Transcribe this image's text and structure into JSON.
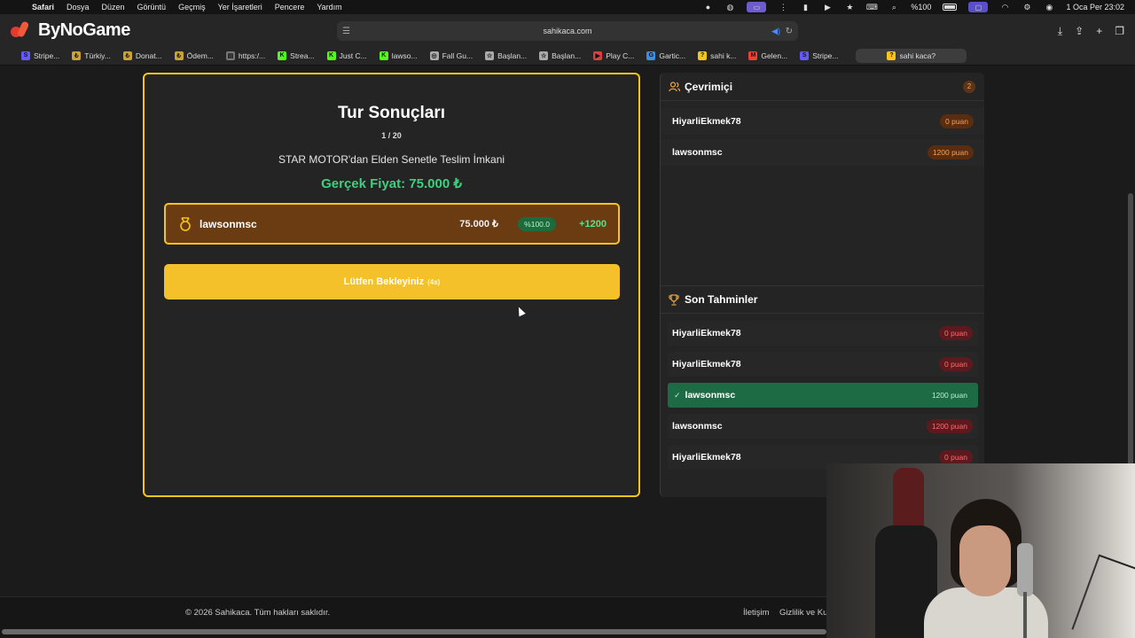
{
  "menubar": {
    "app": "Safari",
    "items": [
      "Dosya",
      "Düzen",
      "Görüntü",
      "Geçmiş",
      "Yer İşaretleri",
      "Pencere",
      "Yardım"
    ],
    "battery": "%100",
    "datetime": "1 Oca Per  23:02"
  },
  "browser": {
    "logo_text": "ByNoGame",
    "url": "sahikaca.com"
  },
  "bookmarks": [
    {
      "label": "Stripe...",
      "icon": "stripe-icon",
      "color": "#635bff",
      "glyph": "S"
    },
    {
      "label": "Türkiy...",
      "icon": "coin-icon",
      "color": "#c9a23a",
      "glyph": "₺"
    },
    {
      "label": "Donat...",
      "icon": "coin-icon",
      "color": "#c9a23a",
      "glyph": "₺"
    },
    {
      "label": "Ödem...",
      "icon": "coin-icon",
      "color": "#c9a23a",
      "glyph": "₺"
    },
    {
      "label": "https:/...",
      "icon": "page-icon",
      "color": "#777777",
      "glyph": "▤"
    },
    {
      "label": "Strea...",
      "icon": "kick-icon",
      "color": "#53fc18",
      "glyph": "K"
    },
    {
      "label": "Just C...",
      "icon": "kick-icon",
      "color": "#53fc18",
      "glyph": "K"
    },
    {
      "label": "lawso...",
      "icon": "kick-icon",
      "color": "#53fc18",
      "glyph": "K"
    },
    {
      "label": "Fall Gu...",
      "icon": "globe-icon",
      "color": "#aaaaaa",
      "glyph": "◎"
    },
    {
      "label": "Başlan...",
      "icon": "star-icon",
      "color": "#aaaaaa",
      "glyph": "☆"
    },
    {
      "label": "Başlan...",
      "icon": "star-icon",
      "color": "#aaaaaa",
      "glyph": "☆"
    },
    {
      "label": "Play C...",
      "icon": "play-icon",
      "color": "#d94141",
      "glyph": "▶"
    },
    {
      "label": "Gartic...",
      "icon": "gartic-icon",
      "color": "#3a8ee6",
      "glyph": "G"
    },
    {
      "label": "sahi k...",
      "icon": "question-icon",
      "color": "#f5c518",
      "glyph": "?"
    },
    {
      "label": "Gelen...",
      "icon": "gmail-icon",
      "color": "#ea4335",
      "glyph": "M"
    },
    {
      "label": "Stripe...",
      "icon": "stripe-icon",
      "color": "#635bff",
      "glyph": "S"
    },
    {
      "label": "sahi kaca?",
      "icon": "question-icon",
      "color": "#f5c518",
      "glyph": "?",
      "active": true
    }
  ],
  "round": {
    "title": "Tur Sonuçları",
    "counter": "1 / 20",
    "product": "STAR MOTOR'dan Elden Senetle Teslim İmkani",
    "real_price": "Gerçek Fiyat: 75.000 ₺"
  },
  "winner": {
    "name": "lawsonmsc",
    "guess": "75.000 ₺",
    "accuracy": "%100.0",
    "points": "+1200"
  },
  "wait_button": {
    "label": "Lütfen Bekleyiniz",
    "countdown": "(4s)"
  },
  "online": {
    "title": "Çevrimiçi",
    "count": "2",
    "users": [
      {
        "name": "HiyarliEkmek78",
        "score": "0 puan"
      },
      {
        "name": "lawsonmsc",
        "score": "1200 puan"
      }
    ]
  },
  "guesses": {
    "title": "Son Tahminler",
    "items": [
      {
        "name": "HiyarliEkmek78",
        "score": "0 puan",
        "correct": false
      },
      {
        "name": "HiyarliEkmek78",
        "score": "0 puan",
        "correct": false
      },
      {
        "name": "lawsonmsc",
        "score": "1200 puan",
        "correct": true
      },
      {
        "name": "lawsonmsc",
        "score": "1200 puan",
        "correct": false
      },
      {
        "name": "HiyarliEkmek78",
        "score": "0 puan",
        "correct": false
      }
    ]
  },
  "footer": {
    "copyright": "© 2026 Sahikaca. Tüm hakları saklıdır.",
    "links": [
      "İletişim",
      "Gizlilik ve Ku"
    ]
  },
  "colors": {
    "accent": "#f5c518",
    "success": "#3ecf7f",
    "winner_bg": "#6b3b11"
  }
}
